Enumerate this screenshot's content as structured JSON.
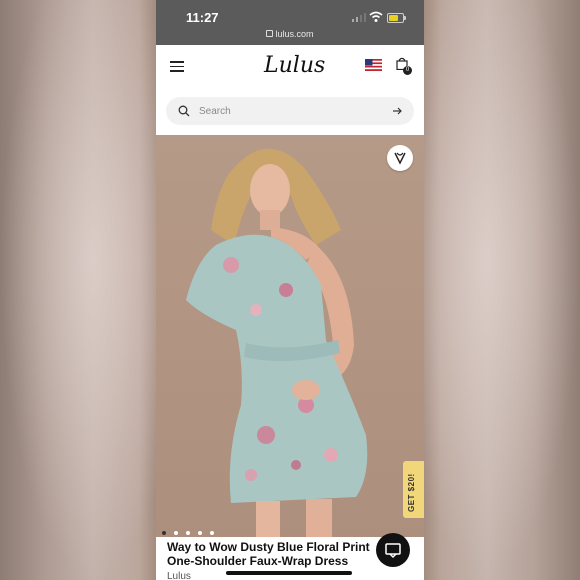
{
  "status_bar": {
    "time": "11:27",
    "url": "lulus.com",
    "battery_color": "#e8d21f"
  },
  "header": {
    "logo_text": "Lulus",
    "menu_icon": "hamburger-menu-icon",
    "flag_icon": "us-flag-icon",
    "bag_icon": "shopping-bag-icon",
    "bag_count": "0"
  },
  "search": {
    "placeholder": "Search",
    "value": ""
  },
  "product": {
    "title": "Way to Wow Dusty Blue Floral Print One-Shoulder Faux-Wrap Dress",
    "brand": "Lulus",
    "image_bg": "#b29482"
  },
  "promo": {
    "label": "GET $20!",
    "color": "#f2d67a"
  },
  "carousel": {
    "total": 5,
    "active_index": 0
  },
  "colors": {
    "status_bar": "#5b5b5b",
    "search_bg": "#f1f1f1",
    "chat_button": "#111111"
  }
}
